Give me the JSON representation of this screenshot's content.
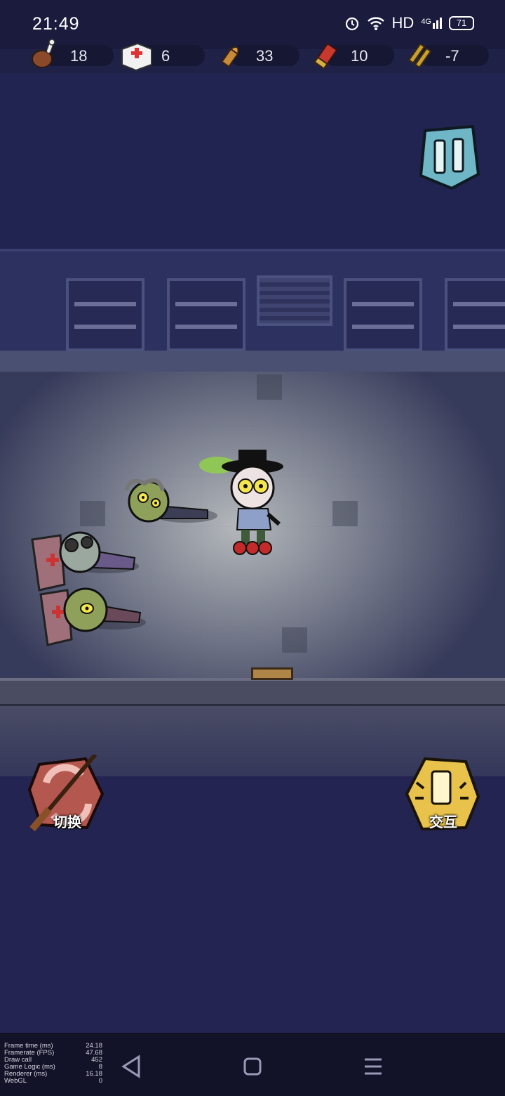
{
  "status_bar": {
    "time": "21:49",
    "network_label": "HD",
    "signal_label": "4G",
    "battery": "71"
  },
  "resources": [
    {
      "name": "food",
      "icon": "drumstick-icon",
      "value": "18"
    },
    {
      "name": "medkit",
      "icon": "medkit-icon",
      "value": "6"
    },
    {
      "name": "pistol_ammo",
      "icon": "bullet-icon",
      "value": "33"
    },
    {
      "name": "shotgun_shells",
      "icon": "shotgun-shell-icon",
      "value": "10"
    },
    {
      "name": "rifle_ammo",
      "icon": "rifle-bullets-icon",
      "value": "-7"
    }
  ],
  "controls": {
    "pause_icon": "pause-icon",
    "switch_label": "切换",
    "interact_label": "交互"
  },
  "debug": [
    {
      "label": "Frame time (ms)",
      "value": "24.18"
    },
    {
      "label": "Framerate (FPS)",
      "value": "47.68"
    },
    {
      "label": "Draw call",
      "value": "452"
    },
    {
      "label": "Game Logic (ms)",
      "value": "8"
    },
    {
      "label": "Renderer (ms)",
      "value": "16.18"
    },
    {
      "label": "WebGL",
      "value": "0"
    }
  ],
  "colors": {
    "background": "#1f2146",
    "floor": "#8e9298",
    "accent": "#e8c24a",
    "switch_button": "#b4574f",
    "pause_button": "#6fb6c6"
  }
}
